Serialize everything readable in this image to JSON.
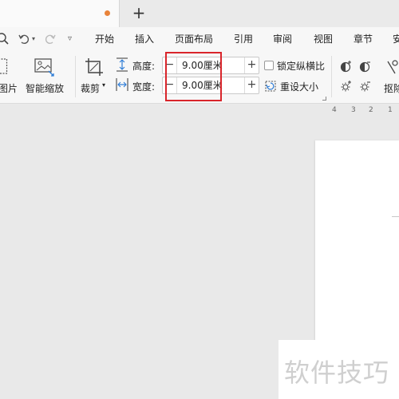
{
  "tabbar": {
    "new_tab_symbol": "+",
    "unsaved_indicator_color": "#e8833a"
  },
  "quick_access": {
    "preview_icon": "print-preview-icon",
    "undo_icon": "undo-icon",
    "undo_dropdown_icon": "chevron-down-icon",
    "redo_icon": "redo-icon",
    "customize_icon": "chevron-down-icon"
  },
  "menu": {
    "items": [
      "开始",
      "插入",
      "页面布局",
      "引用",
      "审阅",
      "视图",
      "章节",
      "安"
    ]
  },
  "ribbon": {
    "image_btn": {
      "label": "图片",
      "icon": "image-icon"
    },
    "smart_zoom_btn": {
      "label": "智能缩放",
      "icon": "smart-zoom-icon"
    },
    "crop_btn": {
      "label": "裁剪",
      "icon": "crop-icon",
      "dropdown": "▾"
    },
    "height": {
      "label": "高度:",
      "value": "9.00厘米",
      "icon": "height-icon"
    },
    "width": {
      "label": "宽度:",
      "value": "9.00厘米",
      "icon": "width-icon"
    },
    "lock_ratio": {
      "label": "锁定纵横比",
      "checked": false
    },
    "reset_size": {
      "label": "重设大小",
      "icon": "reset-size-icon"
    },
    "adjust_icons": [
      "contrast-up-icon",
      "contrast-down-icon",
      "brightness-up-icon",
      "brightness-down-icon"
    ],
    "cutout_btn": {
      "label": "抠除",
      "icon": "cutout-icon"
    },
    "minus_symbol": "−",
    "plus_symbol": "+"
  },
  "ruler": {
    "numbers": [
      "4",
      "3",
      "2",
      "1"
    ]
  },
  "watermark": {
    "text": "软件技巧"
  },
  "colors": {
    "highlight": "#d9252b",
    "tab_dot": "#e8833a"
  }
}
